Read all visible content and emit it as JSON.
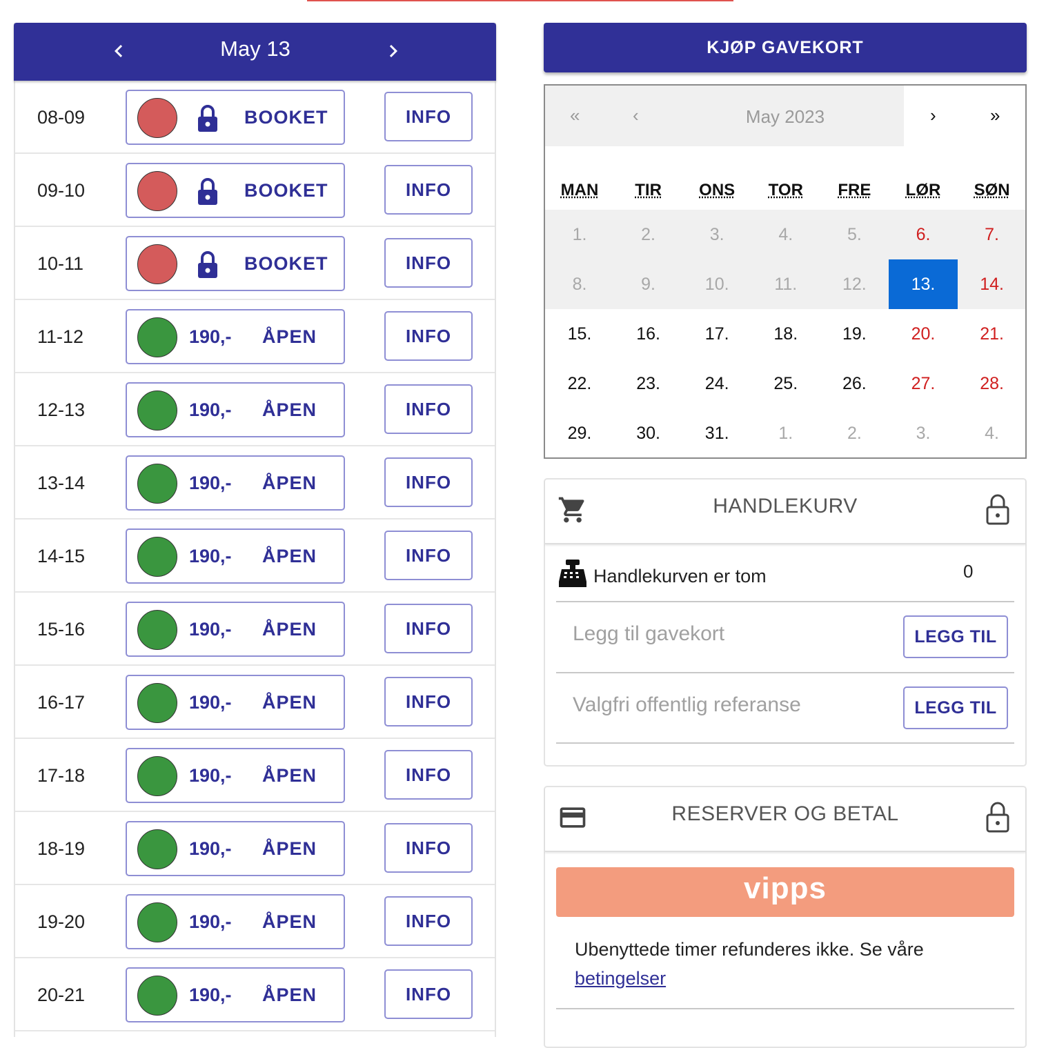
{
  "day_header": {
    "prev_icon": "chevron-left-icon",
    "title": "May 13",
    "next_icon": "chevron-right-icon"
  },
  "slots": [
    {
      "time": "08-09",
      "state": "booked",
      "status_label": "BOOKET",
      "price": "",
      "info_label": "INFO"
    },
    {
      "time": "09-10",
      "state": "booked",
      "status_label": "BOOKET",
      "price": "",
      "info_label": "INFO"
    },
    {
      "time": "10-11",
      "state": "booked",
      "status_label": "BOOKET",
      "price": "",
      "info_label": "INFO"
    },
    {
      "time": "11-12",
      "state": "open",
      "status_label": "ÅPEN",
      "price": "190,-",
      "info_label": "INFO"
    },
    {
      "time": "12-13",
      "state": "open",
      "status_label": "ÅPEN",
      "price": "190,-",
      "info_label": "INFO"
    },
    {
      "time": "13-14",
      "state": "open",
      "status_label": "ÅPEN",
      "price": "190,-",
      "info_label": "INFO"
    },
    {
      "time": "14-15",
      "state": "open",
      "status_label": "ÅPEN",
      "price": "190,-",
      "info_label": "INFO"
    },
    {
      "time": "15-16",
      "state": "open",
      "status_label": "ÅPEN",
      "price": "190,-",
      "info_label": "INFO"
    },
    {
      "time": "16-17",
      "state": "open",
      "status_label": "ÅPEN",
      "price": "190,-",
      "info_label": "INFO"
    },
    {
      "time": "17-18",
      "state": "open",
      "status_label": "ÅPEN",
      "price": "190,-",
      "info_label": "INFO"
    },
    {
      "time": "18-19",
      "state": "open",
      "status_label": "ÅPEN",
      "price": "190,-",
      "info_label": "INFO"
    },
    {
      "time": "19-20",
      "state": "open",
      "status_label": "ÅPEN",
      "price": "190,-",
      "info_label": "INFO"
    },
    {
      "time": "20-21",
      "state": "open",
      "status_label": "ÅPEN",
      "price": "190,-",
      "info_label": "INFO"
    }
  ],
  "gift_button": {
    "label": "KJØP GAVEKORT"
  },
  "calendar": {
    "nav": {
      "prev_year": "«",
      "prev_month": "‹",
      "month_label": "May 2023",
      "next_month": "›",
      "next_year": "»"
    },
    "weekdays": [
      "MAN",
      "TIR",
      "ONS",
      "TOR",
      "FRE",
      "LØR",
      "SØN"
    ],
    "weeks": [
      [
        {
          "label": "1.",
          "style": "grey"
        },
        {
          "label": "2.",
          "style": "grey"
        },
        {
          "label": "3.",
          "style": "grey"
        },
        {
          "label": "4.",
          "style": "grey"
        },
        {
          "label": "5.",
          "style": "grey"
        },
        {
          "label": "6.",
          "style": "red"
        },
        {
          "label": "7.",
          "style": "red"
        }
      ],
      [
        {
          "label": "8.",
          "style": "grey"
        },
        {
          "label": "9.",
          "style": "grey"
        },
        {
          "label": "10.",
          "style": "grey"
        },
        {
          "label": "11.",
          "style": "grey"
        },
        {
          "label": "12.",
          "style": "grey"
        },
        {
          "label": "13.",
          "style": "sel"
        },
        {
          "label": "14.",
          "style": "red"
        }
      ],
      [
        {
          "label": "15.",
          "style": "black"
        },
        {
          "label": "16.",
          "style": "black"
        },
        {
          "label": "17.",
          "style": "black"
        },
        {
          "label": "18.",
          "style": "black"
        },
        {
          "label": "19.",
          "style": "black"
        },
        {
          "label": "20.",
          "style": "red"
        },
        {
          "label": "21.",
          "style": "red"
        }
      ],
      [
        {
          "label": "22.",
          "style": "black"
        },
        {
          "label": "23.",
          "style": "black"
        },
        {
          "label": "24.",
          "style": "black"
        },
        {
          "label": "25.",
          "style": "black"
        },
        {
          "label": "26.",
          "style": "black"
        },
        {
          "label": "27.",
          "style": "red"
        },
        {
          "label": "28.",
          "style": "red"
        }
      ],
      [
        {
          "label": "29.",
          "style": "black"
        },
        {
          "label": "30.",
          "style": "black"
        },
        {
          "label": "31.",
          "style": "black"
        },
        {
          "label": "1.",
          "style": "grey"
        },
        {
          "label": "2.",
          "style": "grey"
        },
        {
          "label": "3.",
          "style": "grey"
        },
        {
          "label": "4.",
          "style": "grey"
        }
      ]
    ],
    "disabled_weeks": 2,
    "selected_date": "13."
  },
  "cart": {
    "icon": "shopping-cart-icon",
    "title": "HANDLEKURV",
    "lock_icon": "lock-icon",
    "register_icon": "cash-register-icon",
    "empty_text": "Handlekurven er tom",
    "count": "0",
    "giftcard_placeholder": "Legg til gavekort",
    "giftcard_button": "LEGG TIL",
    "reference_placeholder": "Valgfri offentlig referanse",
    "reference_button": "LEGG TIL"
  },
  "payment": {
    "icon": "credit-card-icon",
    "title": "RESERVER OG BETAL",
    "lock_icon": "lock-icon",
    "vipps_label": "vipps",
    "terms_text": "Ubenyttede timer refunderes ikke. Se våre",
    "terms_link": "betingelser"
  },
  "colors": {
    "primary": "#303097",
    "booked": "#d45b5b",
    "open": "#3a963f",
    "weekend": "#d01f1f",
    "selected": "#0a6ad6",
    "vipps": "#f39c7e"
  }
}
